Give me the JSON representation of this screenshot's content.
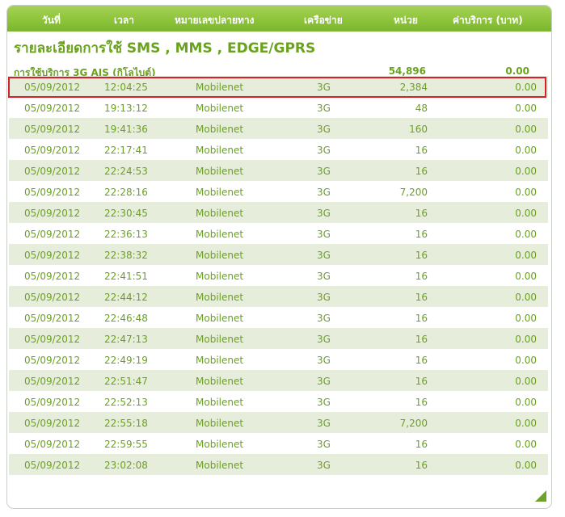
{
  "header": {
    "date": "วันที่",
    "time": "เวลา",
    "destination": "หมายเลขปลายทาง",
    "network": "เครือข่าย",
    "units": "หน่วย",
    "cost": "ค่าบริการ (บาท)"
  },
  "title": "รายละเอียดการใช้ SMS , MMS , EDGE/GPRS",
  "summary": {
    "label": "การใช้บริการ 3G AIS (กิโลไบต์)",
    "units": "54,896",
    "cost": "0.00"
  },
  "rows": [
    {
      "date": "05/09/2012",
      "time": "12:04:25",
      "number": "Mobilenet",
      "network": "3G",
      "units": "2,384",
      "cost": "0.00"
    },
    {
      "date": "05/09/2012",
      "time": "19:13:12",
      "number": "Mobilenet",
      "network": "3G",
      "units": "48",
      "cost": "0.00"
    },
    {
      "date": "05/09/2012",
      "time": "19:41:36",
      "number": "Mobilenet",
      "network": "3G",
      "units": "160",
      "cost": "0.00"
    },
    {
      "date": "05/09/2012",
      "time": "22:17:41",
      "number": "Mobilenet",
      "network": "3G",
      "units": "16",
      "cost": "0.00"
    },
    {
      "date": "05/09/2012",
      "time": "22:24:53",
      "number": "Mobilenet",
      "network": "3G",
      "units": "16",
      "cost": "0.00"
    },
    {
      "date": "05/09/2012",
      "time": "22:28:16",
      "number": "Mobilenet",
      "network": "3G",
      "units": "7,200",
      "cost": "0.00"
    },
    {
      "date": "05/09/2012",
      "time": "22:30:45",
      "number": "Mobilenet",
      "network": "3G",
      "units": "16",
      "cost": "0.00"
    },
    {
      "date": "05/09/2012",
      "time": "22:36:13",
      "number": "Mobilenet",
      "network": "3G",
      "units": "16",
      "cost": "0.00"
    },
    {
      "date": "05/09/2012",
      "time": "22:38:32",
      "number": "Mobilenet",
      "network": "3G",
      "units": "16",
      "cost": "0.00"
    },
    {
      "date": "05/09/2012",
      "time": "22:41:51",
      "number": "Mobilenet",
      "network": "3G",
      "units": "16",
      "cost": "0.00"
    },
    {
      "date": "05/09/2012",
      "time": "22:44:12",
      "number": "Mobilenet",
      "network": "3G",
      "units": "16",
      "cost": "0.00"
    },
    {
      "date": "05/09/2012",
      "time": "22:46:48",
      "number": "Mobilenet",
      "network": "3G",
      "units": "16",
      "cost": "0.00"
    },
    {
      "date": "05/09/2012",
      "time": "22:47:13",
      "number": "Mobilenet",
      "network": "3G",
      "units": "16",
      "cost": "0.00"
    },
    {
      "date": "05/09/2012",
      "time": "22:49:19",
      "number": "Mobilenet",
      "network": "3G",
      "units": "16",
      "cost": "0.00"
    },
    {
      "date": "05/09/2012",
      "time": "22:51:47",
      "number": "Mobilenet",
      "network": "3G",
      "units": "16",
      "cost": "0.00"
    },
    {
      "date": "05/09/2012",
      "time": "22:52:13",
      "number": "Mobilenet",
      "network": "3G",
      "units": "16",
      "cost": "0.00"
    },
    {
      "date": "05/09/2012",
      "time": "22:55:18",
      "number": "Mobilenet",
      "network": "3G",
      "units": "7,200",
      "cost": "0.00"
    },
    {
      "date": "05/09/2012",
      "time": "22:59:55",
      "number": "Mobilenet",
      "network": "3G",
      "units": "16",
      "cost": "0.00"
    },
    {
      "date": "05/09/2012",
      "time": "23:02:08",
      "number": "Mobilenet",
      "network": "3G",
      "units": "16",
      "cost": "0.00"
    }
  ],
  "colors": {
    "header_green": "#8dc43b",
    "text_green": "#6aa21e",
    "row_stripe": "#e7eddb",
    "highlight_red": "#d9202a"
  },
  "icons": {
    "resize_grip": "resize-grip-icon"
  }
}
